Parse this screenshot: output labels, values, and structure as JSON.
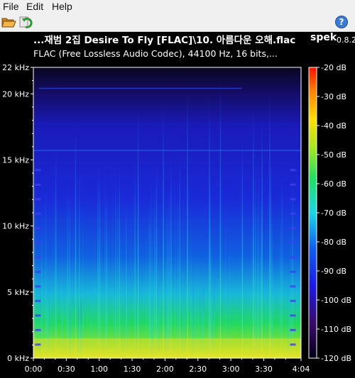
{
  "menu": {
    "file": "File",
    "edit": "Edit",
    "help": "Help"
  },
  "toolbar": {
    "open_icon": "folder-open-icon",
    "reload_icon": "reload-icon",
    "help_icon": "help-icon",
    "help_glyph": "?"
  },
  "header": {
    "title": "...재범 2집 Desire To Fly [FLAC]\\10. 아름다운 오해.flac",
    "brand": "spek",
    "version": "0.8.2",
    "info": "FLAC (Free Lossless Audio Codec), 44100 Hz, 16 bits,..."
  },
  "chart_data": {
    "type": "heatmap",
    "x_ticks": [
      "0:00",
      "0:30",
      "1:00",
      "1:30",
      "2:00",
      "2:30",
      "3:00",
      "3:30",
      "4:04"
    ],
    "y_ticks": [
      "0 kHz",
      "5 kHz",
      "10 kHz",
      "15 kHz",
      "20 kHz",
      "22 kHz"
    ],
    "colorbar_ticks": [
      "-20 dB",
      "-30 dB",
      "-40 dB",
      "-50 dB",
      "-60 dB",
      "-70 dB",
      "-80 dB",
      "-90 dB",
      "-100 dB",
      "-110 dB",
      "-120 dB"
    ],
    "x_range_seconds": [
      0,
      244
    ],
    "y_range_khz": [
      0,
      22
    ],
    "color_range_db": [
      -120,
      -20
    ],
    "colors": {
      "low": "#000010",
      "mid_low": "#1a20e8",
      "mid": "#18e0e0",
      "mid_high": "#30e030",
      "high": "#ffe000",
      "max": "#ff2000"
    }
  }
}
